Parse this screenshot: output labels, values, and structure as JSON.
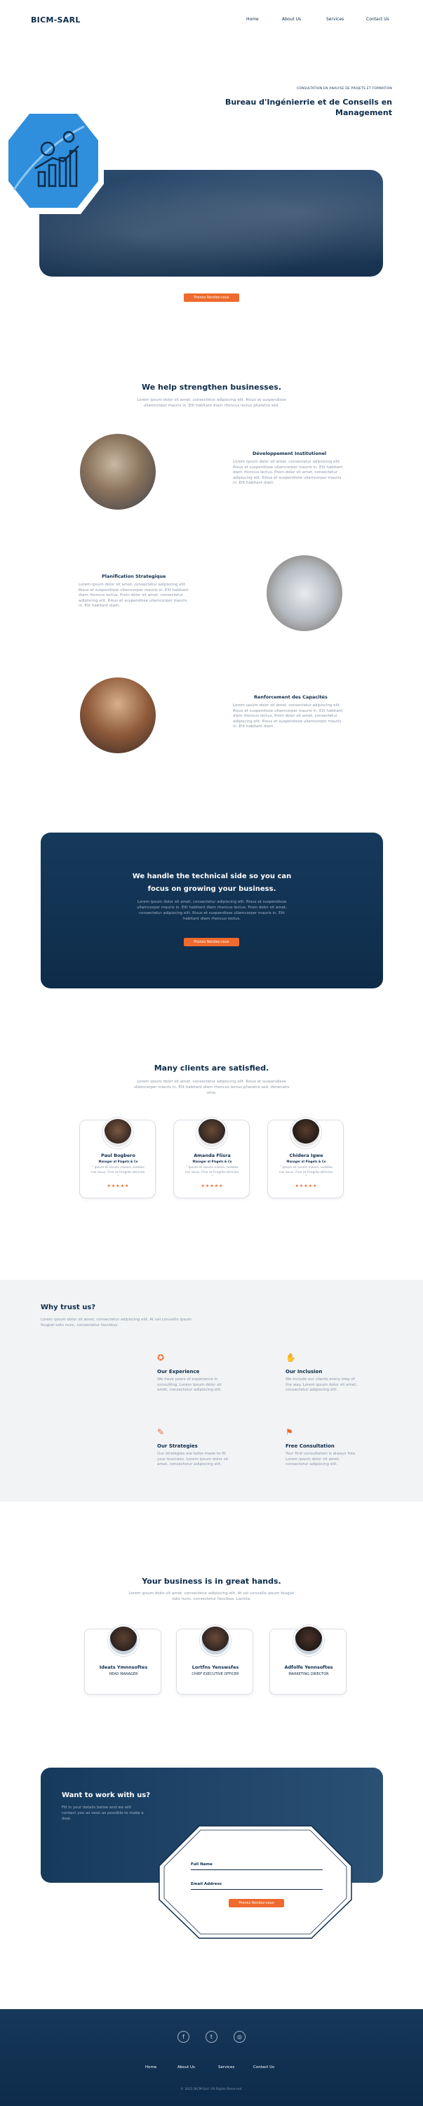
{
  "header": {
    "logo": "BICM-SARL",
    "nav": [
      "Home",
      "About Us",
      "Services",
      "Contact Us"
    ]
  },
  "hero": {
    "eyebrow": "CONSULTATION EN ANALYSE DE PROJETS ET FORMATION",
    "title": "Bureau d'Ingénierrie et de Conseils en Management",
    "cta": "Prenez Rendez-vous"
  },
  "strengthen": {
    "title": "We help strengthen businesses.",
    "subtitle": "Lorem ipsum dolor sit amet, consectetur adipiscing elit. Risus et suspendisse ullamcorper mauris in. Elit habitant diam rhoncus lectus pharetra sed.",
    "services": [
      {
        "title": "Développement Institutionel",
        "text": "Lorem ipsum dolor sit amet, consectetur adipiscing elit. Risus et suspendisse ullamcorper mauris in. Elit habitant diam rhoncus lectus. Proin dolor sit amet, consectetur adipiscing elit. Risus et suspendisse ullamcorper mauris in. Elit habitant diam."
      },
      {
        "title": "Planification Strategique",
        "text": "Lorem ipsum dolor sit amet, consectetur adipiscing elit. Risus et suspendisse ullamcorper mauris in. Elit habitant diam rhoncus lectus. Proin dolor sit amet, consectetur adipiscing elit. Risus et suspendisse ullamcorper mauris in. Elit habitant diam."
      },
      {
        "title": "Renforcement des Capacités",
        "text": "Lorem ipsum dolor sit amet, consectetur adipiscing elit. Risus et suspendisse ullamcorper mauris in. Elit habitant diam rhoncus lectus. Proin dolor sit amet, consectetur adipiscing elit. Risus et suspendisse ullamcorper mauris in. Elit habitant diam."
      }
    ]
  },
  "cta_block": {
    "title": "We handle the technical side so you can focus on growing your business.",
    "text": "Lorem ipsum dolor sit amet, consectetur adipiscing elit. Risus et suspendisse ullamcorper mauris in. Elit habitant diam rhoncus lectus. Proin dolor sit amet, consectetur adipiscing elit. Risus et suspendisse ullamcorper mauris in. Elit habitant diam rhoncus lectus.",
    "button": "Prenez Rendez-vous"
  },
  "testimonials": {
    "title": "Many clients are satisfied.",
    "subtitle": "Lorem ipsum dolor sit amet, consectetur adipiscing elit. Risus et suspendisse ullamcorper mauris in. Elit habitant diam rhoncus lectus pharetra sed. Venenatis urna.",
    "items": [
      {
        "name": "Paul Bogbero",
        "role": "Manager at Piagets & Co",
        "quote": "\" Ipsum et iaculis massa, sodales nisi lacus. Fine at fringilla ultricies. \"",
        "stars": "★★★★★"
      },
      {
        "name": "Amanda Flisra",
        "role": "Manager at Piagets & Co",
        "quote": "\" Ipsum et iaculis massa, sodales nisi lacus. Fine at fringilla ultricies. \"",
        "stars": "★★★★★"
      },
      {
        "name": "Chidera Igwe",
        "role": "Manager at Piagets & Co",
        "quote": "\" Ipsum et iaculis massa, sodales nisi lacus. Fine at fringilla ultricies. \"",
        "stars": "★★★★★"
      }
    ]
  },
  "why": {
    "title": "Why trust us?",
    "subtitle": "Lorem ipsum dolor sit amet, consectetur adipiscing elit. At vel convallis ipsum feugiat odio nunc, consectetur faucibus.",
    "features": [
      {
        "icon": "medal-icon",
        "title": "Our Experience",
        "text": "We have years of experience in consulting. Lorem ipsum dolor sit amet, consectetur adipiscing elit."
      },
      {
        "icon": "hands-icon",
        "title": "Our Inclusion",
        "text": "We include our clients every step of the way. Lorem ipsum dolor sit amet, consectetur adipiscing elit."
      },
      {
        "icon": "strategy-icon",
        "title": "Our Strategies",
        "text": "Our strategies are tailor-made to fit your business. Lorem ipsum dolor sit amet, consectetur adipiscing elit."
      },
      {
        "icon": "handshake-icon",
        "title": "Free Consultation",
        "text": "Your first consultation is always free. Lorem ipsum dolor sit amet, consectetur adipiscing elit."
      }
    ]
  },
  "team": {
    "title": "Your business is in great hands.",
    "subtitle": "Lorem ipsum dolor sit amet, consectetur adipiscing elit. At vel convallis ipsum feugiat odio nunc, consectetur faucibus. Lacinia.",
    "members": [
      {
        "name": "Ideats Ymnnsoftes",
        "role": "HEAD MANAGER"
      },
      {
        "name": "Lortfns Yenswsfes",
        "role": "CHIEF EXECUTIVE OFFICER"
      },
      {
        "name": "Adfolfe Yennsoftes",
        "role": "MARKETING DIRECTOR"
      }
    ]
  },
  "contact": {
    "title": "Want to work with us?",
    "text": "Fill in your details below and we will contact you as soon as possible to make a deal.",
    "full_name_label": "Full Name",
    "email_label": "Email Address",
    "button": "Prenez Rendez-vous"
  },
  "footer": {
    "social": [
      {
        "icon": "facebook-icon",
        "glyph": "f"
      },
      {
        "icon": "twitter-icon",
        "glyph": "t"
      },
      {
        "icon": "instagram-icon",
        "glyph": "◎"
      }
    ],
    "nav": [
      "Home",
      "About Us",
      "Services",
      "Contact Us"
    ],
    "copyright": "© 2022 BICM-Sarl. All Rights Reserved."
  },
  "colors": {
    "navy": "#0d2b4a",
    "accent": "#ef6a2e",
    "light_bg": "#f2f3f5"
  }
}
